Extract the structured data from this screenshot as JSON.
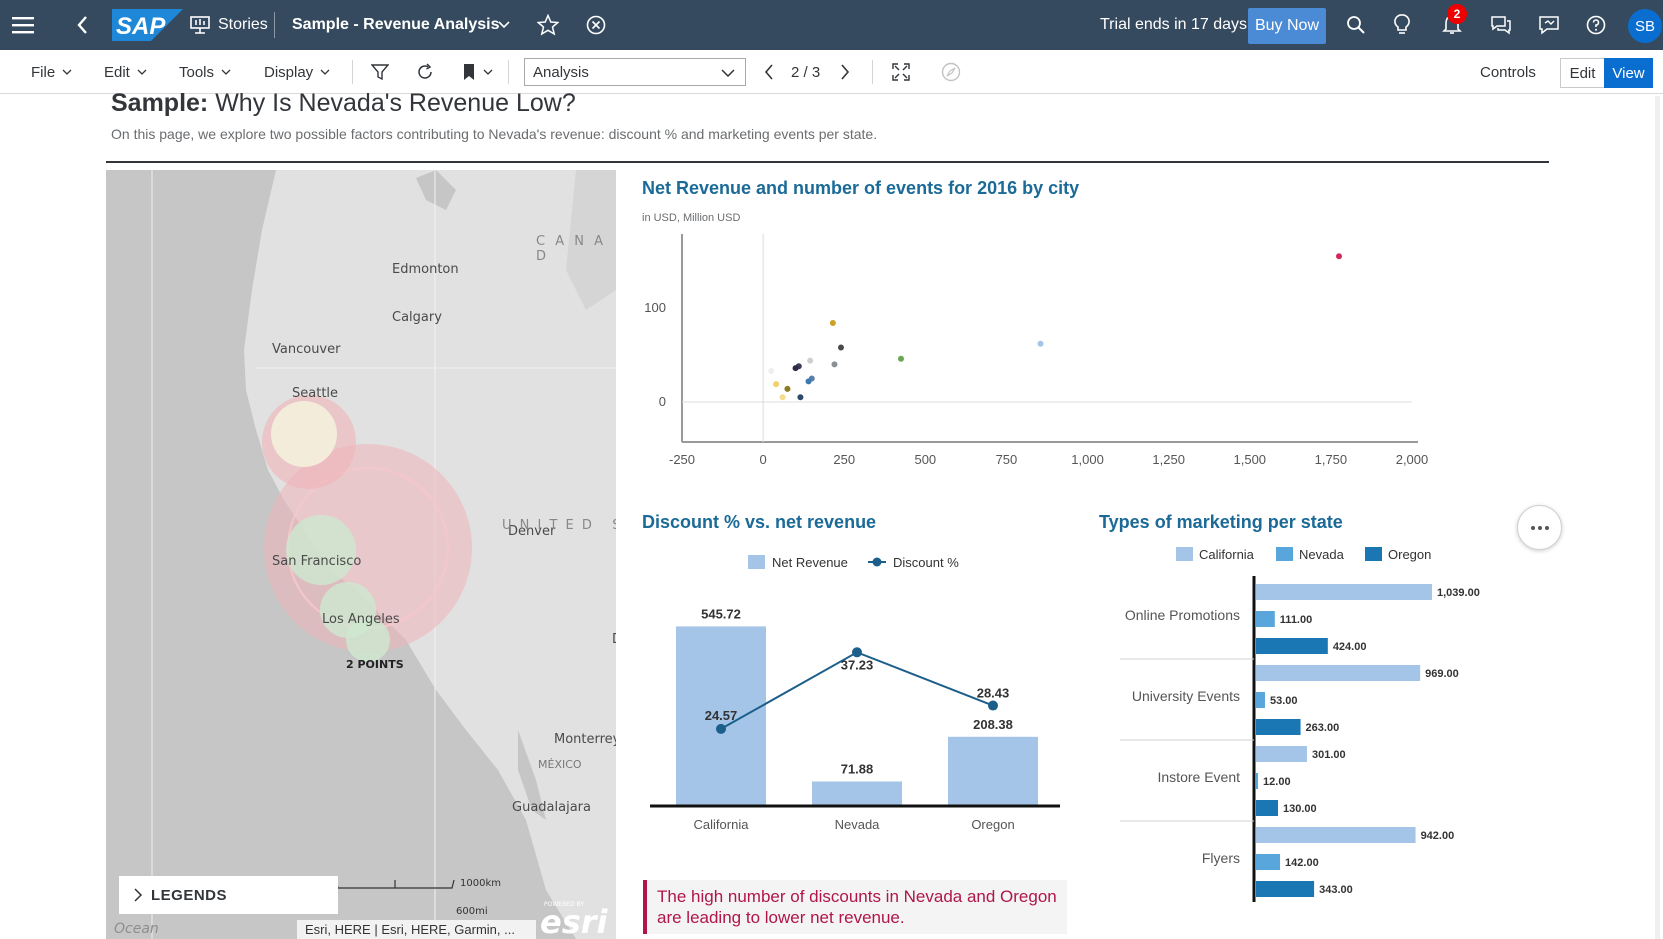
{
  "shell": {
    "brand": "SAP",
    "stories_label": "Stories",
    "story_title": "Sample - Revenue Analysis",
    "trial_text": "Trial ends in 17 days",
    "buy_label": "Buy Now",
    "notification_count": "2",
    "avatar_initials": "SB"
  },
  "toolbar": {
    "menus": [
      "File",
      "Edit",
      "Tools",
      "Display"
    ],
    "page_select": "Analysis",
    "page_indicator": "2 / 3",
    "controls_label": "Controls",
    "edit_label": "Edit",
    "view_label": "View"
  },
  "page": {
    "title_bold": "Sample:",
    "title_rest": " Why Is Nevada's Revenue Low?",
    "subtitle": "On this page, we explore two possible factors contributing to Nevada's revenue: discount % and marketing events per state."
  },
  "map": {
    "labels": [
      "Edmonton",
      "Calgary",
      "Vancouver",
      "Seattle",
      "San Francisco",
      "Los Angeles",
      "Denver",
      "Monterrey",
      "MÉXICO",
      "Guadalajara",
      "C A N A D",
      "U N I T E D   S",
      "D",
      "Ocean"
    ],
    "cluster_label": "2 POINTS",
    "legends_label": "LEGENDS",
    "scale_km": "1000km",
    "scale_mi": "600mi",
    "attribution": "Esri, HERE | Esri, HERE, Garmin, ...",
    "esri_powered": "POWERED BY",
    "esri": "esri"
  },
  "insight_text": "The high number of discounts in Nevada and Oregon are leading to lower net revenue.",
  "colors": {
    "shell": "#354a5f",
    "accent": "#0a6ed1",
    "title": "#1b6a97",
    "california": "#a4c5e8",
    "nevada": "#59a6dc",
    "oregon": "#1a77b3",
    "insight": "#b0154b"
  },
  "chart_data": [
    {
      "type": "scatter",
      "title": "Net Revenue and number of events for 2016 by city",
      "subtitle": "in USD, Million USD",
      "xlim": [
        -250,
        2000
      ],
      "x_ticks": [
        "-250",
        "0",
        "250",
        "500",
        "750",
        "1,000",
        "1,250",
        "1,500",
        "1,750",
        "2,000"
      ],
      "y_ticks": [
        "0",
        "100"
      ],
      "points": [
        {
          "x": 1775,
          "y": 155,
          "color": "#d2285a"
        },
        {
          "x": 855,
          "y": 62,
          "color": "#a4c5e8"
        },
        {
          "x": 425,
          "y": 46,
          "color": "#6aa84f"
        },
        {
          "x": 215,
          "y": 84,
          "color": "#c9a227"
        },
        {
          "x": 240,
          "y": 58,
          "color": "#4a4a4a"
        },
        {
          "x": 220,
          "y": 40,
          "color": "#8a8f96"
        },
        {
          "x": 145,
          "y": 44,
          "color": "#cfcfcf"
        },
        {
          "x": 110,
          "y": 38,
          "color": "#3a3a5a"
        },
        {
          "x": 100,
          "y": 36,
          "color": "#2b2b4a"
        },
        {
          "x": 150,
          "y": 25,
          "color": "#5b7fa6"
        },
        {
          "x": 140,
          "y": 22,
          "color": "#3e78b0"
        },
        {
          "x": 25,
          "y": 33,
          "color": "#eeeeee"
        },
        {
          "x": 40,
          "y": 19,
          "color": "#f2d06b"
        },
        {
          "x": 75,
          "y": 14,
          "color": "#8a7a20"
        },
        {
          "x": 60,
          "y": 5,
          "color": "#f5dc8a"
        },
        {
          "x": 115,
          "y": 5,
          "color": "#2e4a6a"
        }
      ]
    },
    {
      "type": "bar",
      "title": "Discount % vs. net revenue",
      "categories": [
        "California",
        "Nevada",
        "Oregon"
      ],
      "series": [
        {
          "name": "Net Revenue",
          "type": "bar",
          "values": [
            545.72,
            71.88,
            208.38
          ],
          "labels": [
            "545.72",
            "71.88",
            "208.38"
          ]
        },
        {
          "name": "Discount %",
          "type": "line",
          "values": [
            24.57,
            37.23,
            28.43
          ],
          "labels": [
            "24.57",
            "37.23",
            "28.43"
          ]
        }
      ],
      "bar_ylim": [
        0,
        550
      ],
      "line_ylim": [
        12,
        50
      ]
    },
    {
      "type": "bar",
      "orientation": "horizontal",
      "title": "Types of marketing per state",
      "categories": [
        "Online Promotions",
        "University Events",
        "Instore Event",
        "Flyers"
      ],
      "series": [
        {
          "name": "California",
          "values": [
            1039,
            969,
            301,
            942
          ],
          "labels": [
            "1,039.00",
            "969.00",
            "301.00",
            "942.00"
          ]
        },
        {
          "name": "Nevada",
          "values": [
            111,
            53,
            12,
            142
          ],
          "labels": [
            "111.00",
            "53.00",
            "12.00",
            "142.00"
          ]
        },
        {
          "name": "Oregon",
          "values": [
            424,
            263,
            130,
            343
          ],
          "labels": [
            "424.00",
            "263.00",
            "130.00",
            "343.00"
          ]
        }
      ],
      "xlim": [
        0,
        1039
      ]
    }
  ]
}
